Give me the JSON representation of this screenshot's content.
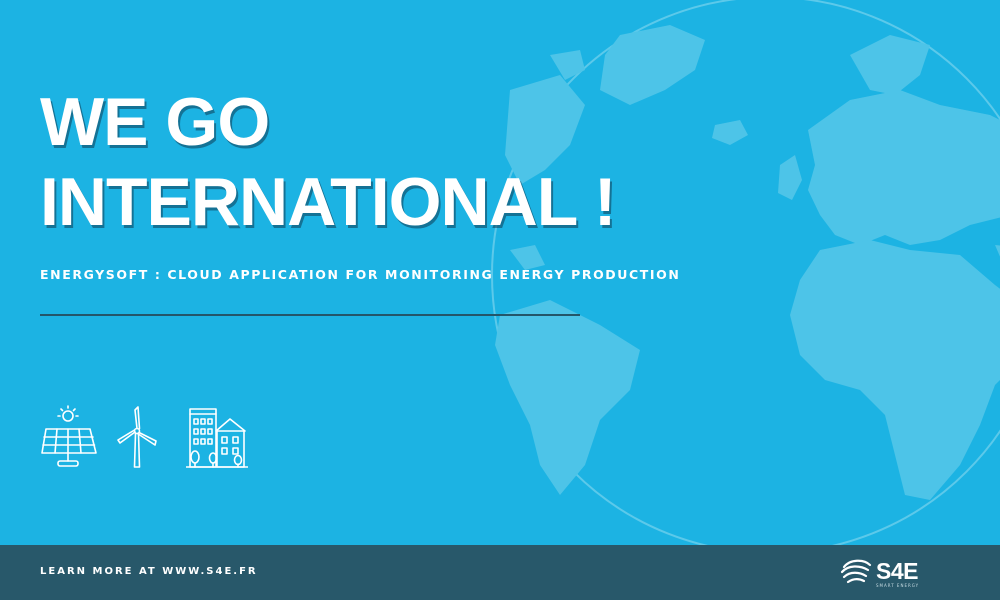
{
  "headline": {
    "line1": "WE GO",
    "line2": "INTERNATIONAL !"
  },
  "subtitle": "ENERGYSOFT : CLOUD APPLICATION FOR MONITORING ENERGY PRODUCTION",
  "icons": [
    "solar-panel-icon",
    "wind-turbine-icon",
    "buildings-icon"
  ],
  "footer": {
    "text": "LEARN MORE AT WWW.S4E.FR",
    "logo_text": "S4E",
    "logo_tagline": "SMART ENERGY"
  },
  "colors": {
    "background": "#1cb3e3",
    "footer": "#28586a",
    "globe": "#4dc4e8",
    "text": "#ffffff"
  }
}
